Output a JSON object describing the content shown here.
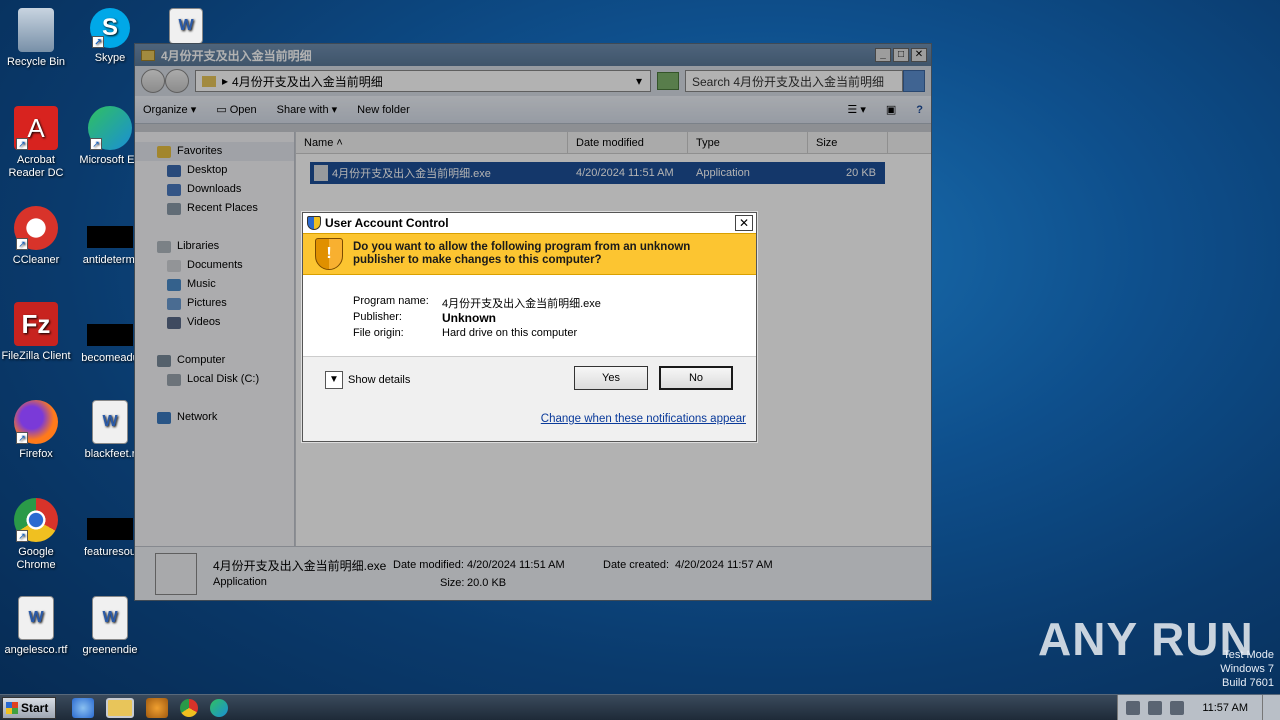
{
  "desktop": {
    "icons": [
      {
        "label": "Recycle Bin",
        "color": "#8aa0b8"
      },
      {
        "label": "Skype",
        "color": "#00a8e8"
      },
      {
        "label": "Acrobat Reader DC",
        "color": "#d8231f"
      },
      {
        "label": "Microsoft Ed",
        "color": "#1a8fd6"
      },
      {
        "label": "CCleaner",
        "color": "#d8332a"
      },
      {
        "label": "antidetermi",
        "color": "#000000"
      },
      {
        "label": "FileZilla Client",
        "color": "#c8231f"
      },
      {
        "label": "becomeadu",
        "color": "#000000"
      },
      {
        "label": "Firefox",
        "color": "#ff7a1a"
      },
      {
        "label": "blackfeet.r",
        "color": "#2a5aa8"
      },
      {
        "label": "Google Chrome",
        "color": "#2a9a48"
      },
      {
        "label": "featuresou",
        "color": "#000000"
      },
      {
        "label": "angelesco.rtf",
        "color": "#2a5aa8"
      },
      {
        "label": "greenendie",
        "color": "#2a5aa8"
      }
    ]
  },
  "explorer": {
    "title": "4月份开支及出入金当前明细",
    "address": "4月份开支及出入金当前明细",
    "search_placeholder": "Search 4月份开支及出入金当前明细",
    "toolbar": {
      "organize": "Organize",
      "open": "Open",
      "share_with": "Share with",
      "new_folder": "New folder"
    },
    "nav": {
      "favorites": "Favorites",
      "desktop": "Desktop",
      "downloads": "Downloads",
      "recent_places": "Recent Places",
      "libraries": "Libraries",
      "documents": "Documents",
      "music": "Music",
      "pictures": "Pictures",
      "videos": "Videos",
      "computer": "Computer",
      "local_disk": "Local Disk (C:)",
      "network": "Network"
    },
    "columns": {
      "name": "Name",
      "date_modified": "Date modified",
      "type": "Type",
      "size": "Size"
    },
    "file": {
      "name": "4月份开支及出入金当前明细.exe",
      "date_modified": "4/20/2024 11:51 AM",
      "type": "Application",
      "size": "20 KB"
    },
    "details": {
      "name": "4月份开支及出入金当前明细.exe",
      "type": "Application",
      "date_modified_label": "Date modified:",
      "date_modified": "4/20/2024 11:51 AM",
      "size_label": "Size:",
      "size": "20.0 KB",
      "date_created_label": "Date created:",
      "date_created": "4/20/2024 11:57 AM"
    }
  },
  "uac": {
    "title": "User Account Control",
    "question": "Do you want to allow the following program from an unknown publisher to make changes to this computer?",
    "program_name_label": "Program name:",
    "program_name": "4月份开支及出入金当前明细.exe",
    "publisher_label": "Publisher:",
    "publisher": "Unknown",
    "file_origin_label": "File origin:",
    "file_origin": "Hard drive on this computer",
    "show_details": "Show details",
    "yes": "Yes",
    "no": "No",
    "link": "Change when these notifications appear"
  },
  "taskbar": {
    "start": "Start",
    "clock": "11:57 AM"
  },
  "watermark": "ANY RUN",
  "testmode": {
    "line1": "Test Mode",
    "line2": "Windows 7",
    "line3": "Build 7601"
  }
}
